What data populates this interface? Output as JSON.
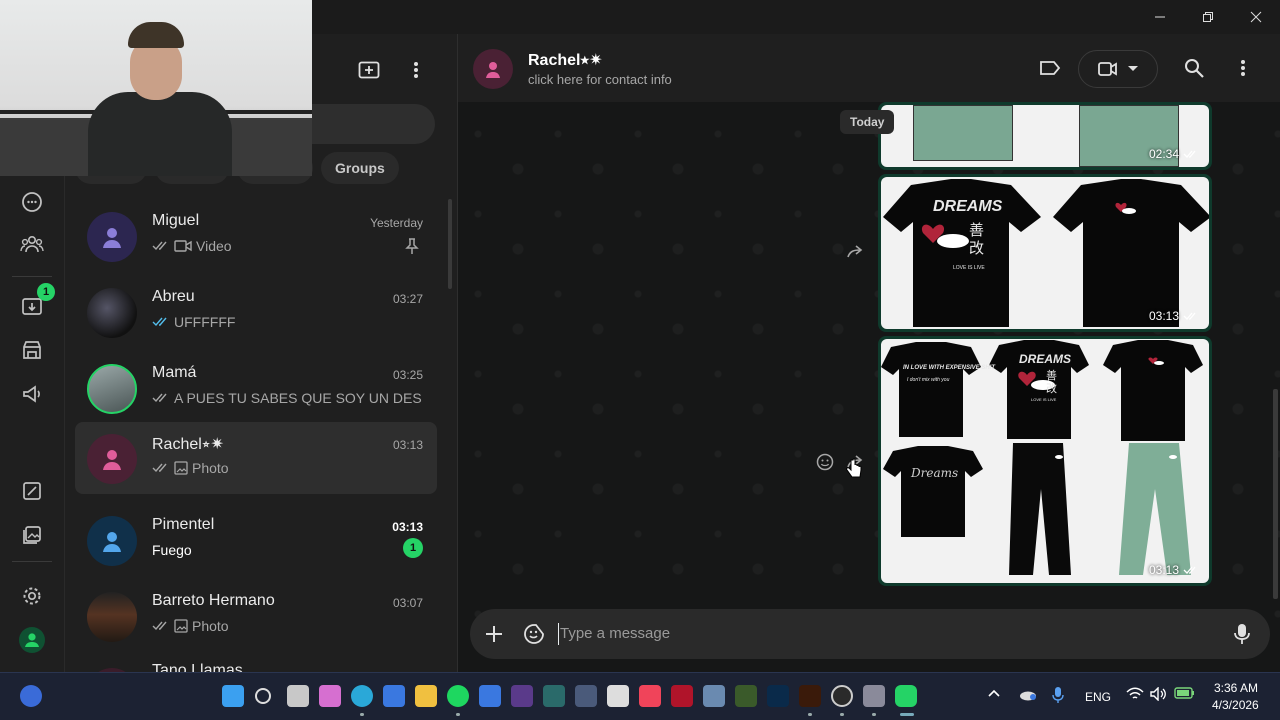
{
  "window": {
    "controls": [
      "minimize",
      "maximize",
      "close"
    ]
  },
  "rail": {
    "archived_badge": "1"
  },
  "chatlist": {
    "filter_visible": "Groups",
    "chats": [
      {
        "name": "Miguel",
        "time": "Yesterday",
        "preview": "Video",
        "pinned": true
      },
      {
        "name": "Abreu",
        "time": "03:27",
        "preview": "UFFFFFF"
      },
      {
        "name": "Mamá",
        "time": "03:25",
        "preview": "A PUES TU SABES QUE SOY UN DESI..."
      },
      {
        "name": "Rachel⭒✷",
        "time": "03:13",
        "preview": "Photo"
      },
      {
        "name": "Pimentel",
        "time": "03:13",
        "preview": "Fuego",
        "unread": "1"
      },
      {
        "name": "Barreto Hermano",
        "time": "03:07",
        "preview": "Photo"
      },
      {
        "name": "Tano Llamas",
        "time": "",
        "preview": ""
      }
    ]
  },
  "conversation": {
    "contact_name": "Rachel⭒✷",
    "contact_sub": "click here for contact info",
    "date_divider": "Today",
    "messages": [
      {
        "time": "02:34"
      },
      {
        "time": "03:13",
        "texts": [
          "DREAMS",
          "善",
          "改",
          "LOVE IS LIVE"
        ]
      },
      {
        "time": "03:13",
        "texts": [
          "IN LOVE WITH EXPENSIVE SHIT",
          "I don't mix with you",
          "DREAMS",
          "善",
          "改",
          "LOVE IS LIVE",
          "Dreams"
        ]
      }
    ],
    "composer_placeholder": "Type a message"
  },
  "taskbar": {
    "lang": "ENG",
    "time": "3:36 AM",
    "date": "4/3/2026"
  },
  "colors": {
    "accent": "#25d366",
    "bubble_out": "#0f3a2c",
    "active_row": "#2e2e2e"
  }
}
